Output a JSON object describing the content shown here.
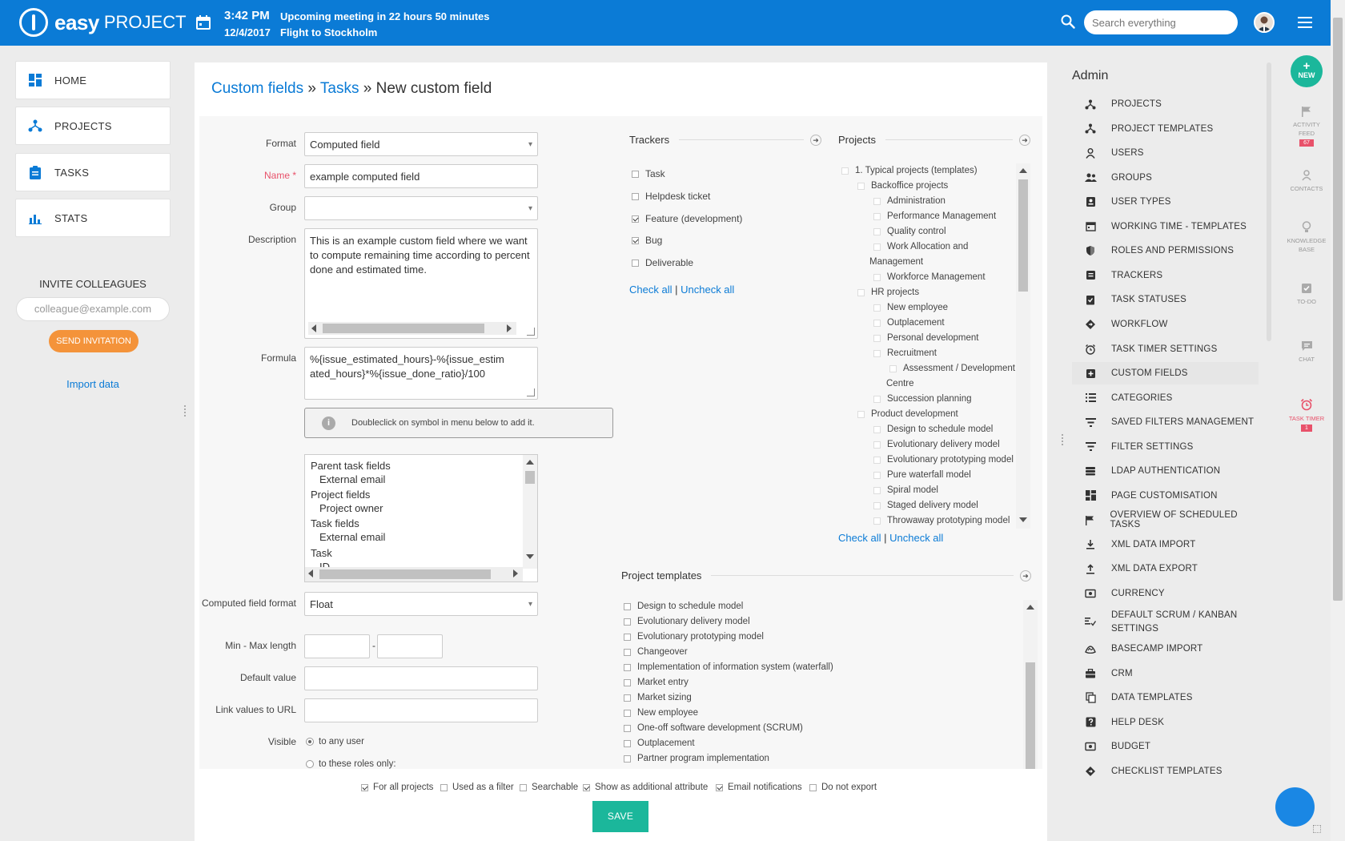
{
  "topbar": {
    "logo_bold": "easy",
    "logo_light": "PROJECT",
    "time": "3:42 PM",
    "date": "12/4/2017",
    "event1": "Upcoming meeting in 22 hours 50 minutes",
    "event2": "Flight to Stockholm",
    "search_placeholder": "Search everything"
  },
  "leftnav": {
    "items": [
      {
        "label": "HOME",
        "icon": "dashboard-icon"
      },
      {
        "label": "PROJECTS",
        "icon": "projects-icon"
      },
      {
        "label": "TASKS",
        "icon": "clipboard-icon"
      },
      {
        "label": "STATS",
        "icon": "bar-chart-icon"
      }
    ],
    "invite_title": "INVITE COLLEAGUES",
    "invite_placeholder": "colleague@example.com",
    "send_invitation": "SEND INVITATION",
    "import_data": "Import data"
  },
  "breadcrumb": {
    "part1": "Custom fields",
    "sep": "»",
    "part2": "Tasks",
    "current": "New custom field"
  },
  "form": {
    "format_label": "Format",
    "format_value": "Computed field",
    "name_label": "Name *",
    "name_value": "example computed field",
    "group_label": "Group",
    "group_value": "",
    "description_label": "Description",
    "description_value": "This is an example custom field where we want to compute remaining time according to percent done and estimated time.",
    "formula_label": "Formula",
    "formula_value": "%{issue_estimated_hours}-%{issue_estimated_hours}*%{issue_done_ratio}/100",
    "hint_icon": "i",
    "hint": "Doubleclick on symbol in menu below to add it.",
    "symbols": [
      {
        "text": "Parent task fields",
        "indent": false
      },
      {
        "text": "External email",
        "indent": true
      },
      {
        "text": "Project fields",
        "indent": false
      },
      {
        "text": "Project owner",
        "indent": true
      },
      {
        "text": "Task fields",
        "indent": false
      },
      {
        "text": "External email",
        "indent": true
      },
      {
        "text": "Task",
        "indent": false
      },
      {
        "text": "ID",
        "indent": true
      }
    ],
    "computed_format_label": "Computed field format",
    "computed_format_value": "Float",
    "minmax_label": "Min - Max length",
    "minmax_sep": "-",
    "default_label": "Default value",
    "link_label": "Link values to URL",
    "visible_label": "Visible",
    "visible_opt1": "to any user",
    "visible_opt2": "to these roles only:"
  },
  "trackers": {
    "title": "Trackers",
    "items": [
      {
        "label": "Task",
        "checked": false
      },
      {
        "label": "Helpdesk ticket",
        "checked": false
      },
      {
        "label": "Feature (development)",
        "checked": true
      },
      {
        "label": "Bug",
        "checked": true
      },
      {
        "label": "Deliverable",
        "checked": false
      }
    ],
    "check_all": "Check all",
    "sep": "|",
    "uncheck_all": "Uncheck all"
  },
  "projects": {
    "title": "Projects",
    "items": [
      {
        "label": "1. Typical projects (templates)",
        "level": 0
      },
      {
        "label": "Backoffice projects",
        "level": 1
      },
      {
        "label": "Administration",
        "level": 2
      },
      {
        "label": "Performance Management",
        "level": 2
      },
      {
        "label": "Quality control",
        "level": 2
      },
      {
        "label": "Work Allocation and",
        "level": 2
      },
      {
        "label": "Management",
        "level": 1,
        "cont": true
      },
      {
        "label": "Workforce Management",
        "level": 2
      },
      {
        "label": "HR projects",
        "level": 1
      },
      {
        "label": "New employee",
        "level": 2
      },
      {
        "label": "Outplacement",
        "level": 2
      },
      {
        "label": "Personal development",
        "level": 2
      },
      {
        "label": "Recruitment",
        "level": 2
      },
      {
        "label": "Assessment / Development",
        "level": 3
      },
      {
        "label": "Centre",
        "level": 2,
        "cont": true
      },
      {
        "label": "Succession planning",
        "level": 2
      },
      {
        "label": "Product development",
        "level": 1
      },
      {
        "label": "Design to schedule model",
        "level": 2
      },
      {
        "label": "Evolutionary delivery model",
        "level": 2
      },
      {
        "label": "Evolutionary prototyping model",
        "level": 2
      },
      {
        "label": "Pure waterfall model",
        "level": 2
      },
      {
        "label": "Spiral model",
        "level": 2
      },
      {
        "label": "Staged delivery model",
        "level": 2
      },
      {
        "label": "Throwaway prototyping model",
        "level": 2
      }
    ],
    "check_all": "Check all",
    "sep": "|",
    "uncheck_all": "Uncheck all"
  },
  "templates": {
    "title": "Project templates",
    "items": [
      "Design to schedule model",
      "Evolutionary delivery model",
      "Evolutionary prototyping model",
      "Changeover",
      "Implementation of information system (waterfall)",
      "Market entry",
      "Market sizing",
      "New employee",
      "One-off software development (SCRUM)",
      "Outplacement",
      "Partner program implementation"
    ]
  },
  "options": [
    {
      "label": "For all projects",
      "checked": true
    },
    {
      "label": "Used as a filter",
      "checked": false
    },
    {
      "label": "Searchable",
      "checked": false
    },
    {
      "label": "Show as additional attribute",
      "checked": true
    },
    {
      "label": "Email notifications",
      "checked": true
    },
    {
      "label": "Do not export",
      "checked": false
    }
  ],
  "save_label": "SAVE",
  "admin": {
    "title": "Admin",
    "items": [
      {
        "label": "PROJECTS",
        "icon": "projects-icon"
      },
      {
        "label": "PROJECT TEMPLATES",
        "icon": "project-templates-icon"
      },
      {
        "label": "USERS",
        "icon": "user-icon"
      },
      {
        "label": "GROUPS",
        "icon": "group-icon"
      },
      {
        "label": "USER TYPES",
        "icon": "id-card-icon"
      },
      {
        "label": "WORKING TIME - TEMPLATES",
        "icon": "calendar-icon"
      },
      {
        "label": "ROLES AND PERMISSIONS",
        "icon": "shield-icon"
      },
      {
        "label": "TRACKERS",
        "icon": "tracker-icon"
      },
      {
        "label": "TASK STATUSES",
        "icon": "check-clipboard-icon"
      },
      {
        "label": "WORKFLOW",
        "icon": "diamond-icon"
      },
      {
        "label": "TASK TIMER SETTINGS",
        "icon": "alarm-icon"
      },
      {
        "label": "CUSTOM FIELDS",
        "icon": "plus-square-icon",
        "active": true
      },
      {
        "label": "CATEGORIES",
        "icon": "list-icon"
      },
      {
        "label": "SAVED FILTERS MANAGEMENT",
        "icon": "filter-icon"
      },
      {
        "label": "FILTER SETTINGS",
        "icon": "filter-icon"
      },
      {
        "label": "LDAP AUTHENTICATION",
        "icon": "database-icon"
      },
      {
        "label": "PAGE CUSTOMISATION",
        "icon": "grid-icon"
      },
      {
        "label": "OVERVIEW OF SCHEDULED TASKS",
        "icon": "flag-icon"
      },
      {
        "label": "XML DATA IMPORT",
        "icon": "download-icon"
      },
      {
        "label": "XML DATA EXPORT",
        "icon": "upload-icon"
      },
      {
        "label": "CURRENCY",
        "icon": "money-icon"
      },
      {
        "label": "DEFAULT SCRUM / KANBAN SETTINGS",
        "icon": "kanban-icon"
      },
      {
        "label": "BASECAMP IMPORT",
        "icon": "basecamp-icon"
      },
      {
        "label": "CRM",
        "icon": "briefcase-icon"
      },
      {
        "label": "DATA TEMPLATES",
        "icon": "copy-icon"
      },
      {
        "label": "HELP DESK",
        "icon": "help-icon"
      },
      {
        "label": "BUDGET",
        "icon": "money-icon"
      },
      {
        "label": "CHECKLIST TEMPLATES",
        "icon": "diamond-icon"
      }
    ]
  },
  "rail": {
    "new_plus": "+",
    "new_label": "NEW",
    "activity_line1": "ACTIVITY",
    "activity_line2": "FEED",
    "activity_badge": "67",
    "contacts": "CONTACTS",
    "kb_line1": "KNOWLEDGE",
    "kb_line2": "BASE",
    "todo": "TO-DO",
    "chat": "CHAT",
    "timer": "TASK TIMER",
    "timer_badge": "1"
  },
  "colors": {
    "brand": "#0b7bd6",
    "accent_green": "#1bb79b",
    "invite_orange": "#f4933a",
    "badge_red": "#e8516a"
  }
}
